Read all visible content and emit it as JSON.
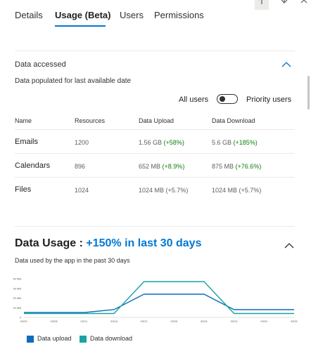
{
  "tabs": [
    {
      "label": "Details"
    },
    {
      "label": "Usage (Beta)"
    },
    {
      "label": "Users"
    },
    {
      "label": "Permissions"
    }
  ],
  "header_icons": [
    "arrow-up-icon",
    "arrow-down-icon",
    "close-icon"
  ],
  "data_accessed": {
    "title": "Data accessed",
    "subtitle": "Data populated for last available date",
    "toggle_left": "All users",
    "toggle_right": "Priority users",
    "toggle_state": "all-users",
    "columns": [
      "Name",
      "Resources",
      "Data Upload",
      "Data Download"
    ],
    "rows": [
      {
        "name": "Emails",
        "resources": "1200",
        "upload": "1.56 GB",
        "upload_change": "(+58%)",
        "download": "5.6 GB",
        "download_change": "(+185%)"
      },
      {
        "name": "Calendars",
        "resources": "896",
        "upload": "652 MB",
        "upload_change": "(+8.9%)",
        "download": "875 MB",
        "download_change": "(+76.6%)"
      },
      {
        "name": "Files",
        "resources": "1024",
        "upload": "1024 MB",
        "upload_change": "(+5.7%)",
        "download": "1024 MB",
        "download_change": "(+5.7%)"
      }
    ]
  },
  "data_usage": {
    "title_prefix": "Data Usage :",
    "title_highlight": "+150% in last 30 days",
    "subtitle": "Data used by the app in the past 30 days"
  },
  "colors": {
    "accent": "#0078d4",
    "positive": "#107c10",
    "upload_series": "#0f6cbd",
    "download_series": "#1aa3a3"
  },
  "chart_data": {
    "type": "line",
    "x": [
      "03/01",
      "03/06",
      "03/11",
      "03/16",
      "03/21",
      "03/26",
      "03/31",
      "03/31",
      "03/31",
      "03/31"
    ],
    "y_ticks": [
      "40 MB",
      "30 MB",
      "20 MB",
      "10 MB",
      "0"
    ],
    "ylim": [
      0,
      40
    ],
    "series": [
      {
        "name": "Data upload",
        "values": [
          5,
          5,
          5,
          8,
          24,
          24,
          24,
          8,
          8,
          8
        ]
      },
      {
        "name": "Data download",
        "values": [
          4,
          4,
          4,
          4,
          37,
          37,
          37,
          4,
          4,
          4
        ]
      }
    ],
    "legend_position": "bottom-left"
  }
}
